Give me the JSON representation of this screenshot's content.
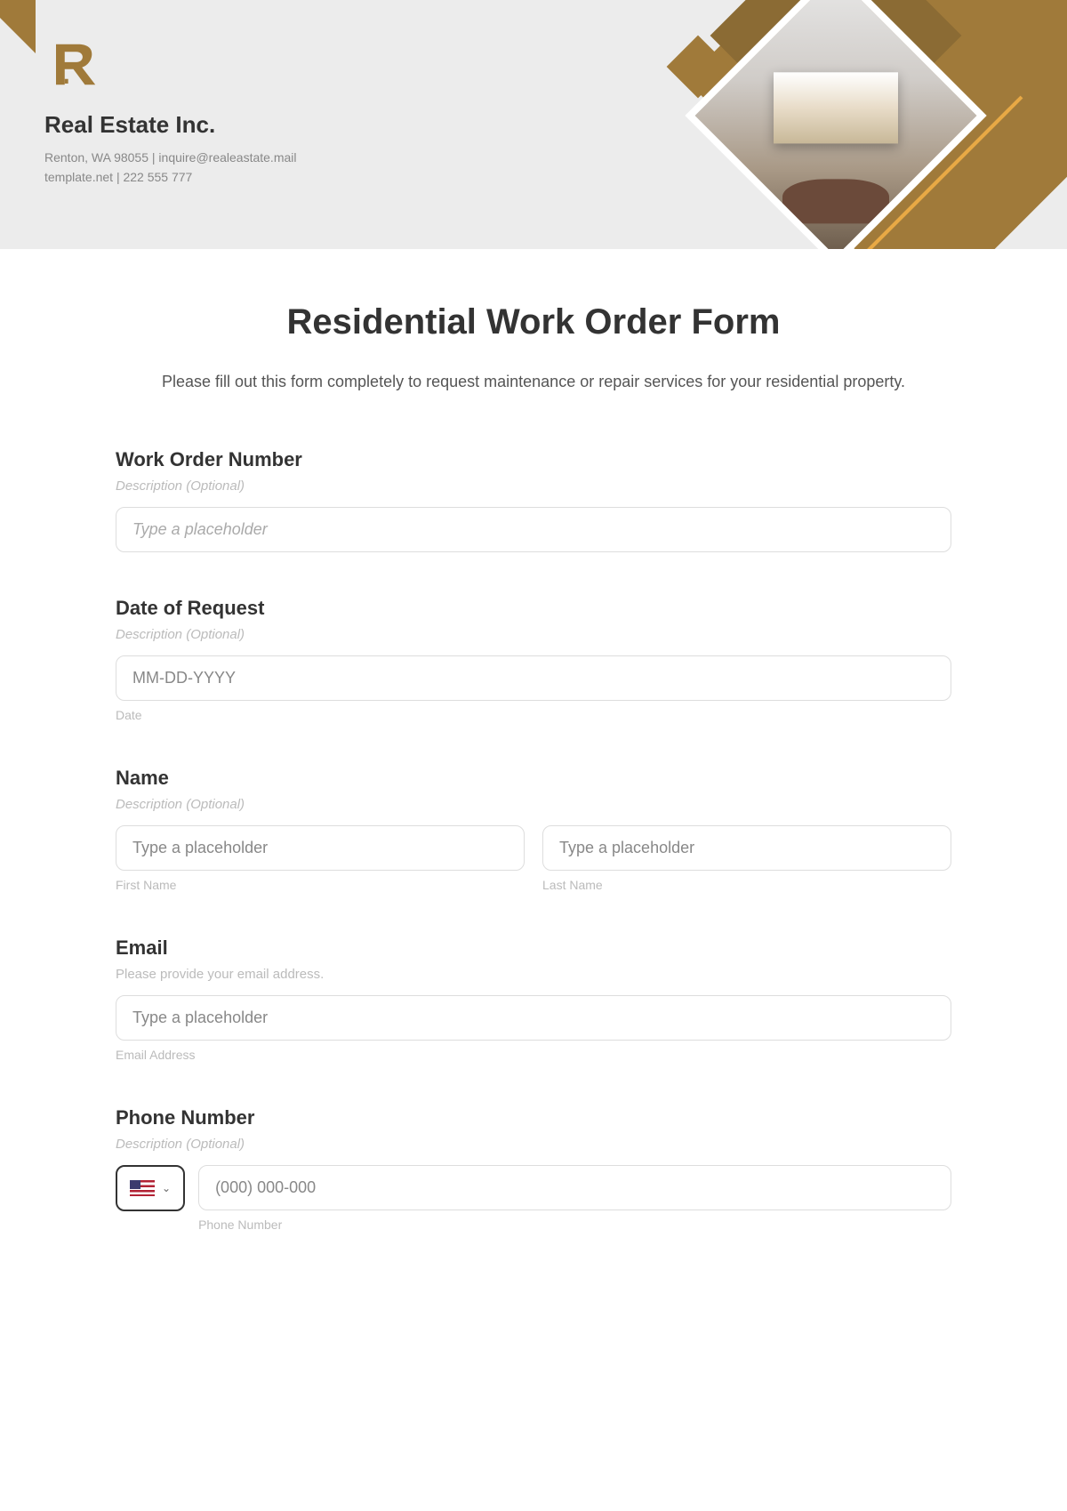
{
  "header": {
    "company_name": "Real Estate Inc.",
    "address_line": "Renton, WA 98055 | inquire@realeastate.mail",
    "contact_line": "template.net | 222 555 777"
  },
  "form": {
    "title": "Residential Work Order Form",
    "intro": "Please fill out this form completely to request maintenance or repair services for your residential property."
  },
  "fields": {
    "work_order": {
      "label": "Work Order Number",
      "description": "Description (Optional)",
      "placeholder": "Type a placeholder"
    },
    "date_request": {
      "label": "Date of Request",
      "description": "Description (Optional)",
      "placeholder": "MM-DD-YYYY",
      "sublabel": "Date"
    },
    "name": {
      "label": "Name",
      "description": "Description (Optional)",
      "first_placeholder": "Type a placeholder",
      "first_sublabel": "First Name",
      "last_placeholder": "Type a placeholder",
      "last_sublabel": "Last Name"
    },
    "email": {
      "label": "Email",
      "description": "Please provide your email address.",
      "placeholder": "Type a placeholder",
      "sublabel": "Email Address"
    },
    "phone": {
      "label": "Phone Number",
      "description": "Description (Optional)",
      "placeholder": "(000) 000-000",
      "sublabel": "Phone Number"
    }
  }
}
